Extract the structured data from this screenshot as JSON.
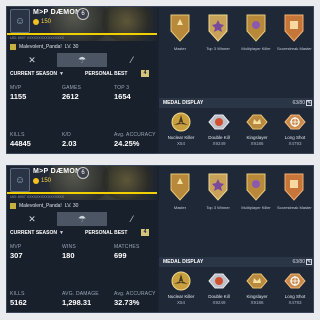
{
  "colors": {
    "accent_yellow": "#f0d000",
    "gold": "#d6b45a",
    "panel": "#1a2230"
  },
  "screens": [
    {
      "profile": {
        "name": "M>P",
        "clan_tag": "DÆMON",
        "level": "6",
        "cp": "150",
        "uid": "UID: 6907 XXXXXXXXXXXXXXXX",
        "title": "Malevolent_Panda!",
        "lv": "LV. 30",
        "current_season_label": "CURRENT SEASON",
        "personal_best_label": "PERSONAL BEST",
        "personal_best_count": "4"
      },
      "stats": [
        {
          "label": "MVP",
          "value": "1155"
        },
        {
          "label": "GAMES",
          "value": "2612"
        },
        {
          "label": "TOP 3",
          "value": "1654"
        },
        {
          "label": "KILLS",
          "value": "44845"
        },
        {
          "label": "K/D",
          "value": "2.03"
        },
        {
          "label": "Avg. ACCURACY",
          "value": "24.25%"
        }
      ],
      "medals": [
        "Master",
        "Top 3 Winner",
        "Multiplayer Killer",
        "Scorestreak Master"
      ],
      "medal_display_label": "MEDAL DISPLAY",
      "medal_display_count": "63/80",
      "display_medals": [
        {
          "name": "Nuclear Killer",
          "count": "X54"
        },
        {
          "name": "Double Kill",
          "count": "X9249"
        },
        {
          "name": "Kingslayer",
          "count": "X9186"
        },
        {
          "name": "Long Shot",
          "count": "X4793"
        }
      ]
    },
    {
      "profile": {
        "name": "M>P",
        "clan_tag": "DÆMON",
        "level": "6",
        "cp": "150",
        "uid": "UID: 6907 XXXXXXXXXXXXXXXX",
        "title": "Malevolent_Panda!",
        "lv": "LV. 30",
        "current_season_label": "CURRENT SEASON",
        "personal_best_label": "PERSONAL BEST",
        "personal_best_count": "4"
      },
      "stats": [
        {
          "label": "MVP",
          "value": "307"
        },
        {
          "label": "WINS",
          "value": "180"
        },
        {
          "label": "MATCHES",
          "value": "699"
        },
        {
          "label": "KILLS",
          "value": "5162"
        },
        {
          "label": "AVG. DAMAGE",
          "value": "1,298.31"
        },
        {
          "label": "Avg. ACCURACY",
          "value": "32.73%"
        }
      ],
      "medals": [
        "Master",
        "Top 3 Winner",
        "Multiplayer Killer",
        "Scorestreak Master"
      ],
      "medal_display_label": "MEDAL DISPLAY",
      "medal_display_count": "63/80",
      "display_medals": [
        {
          "name": "Nuclear Killer",
          "count": "X54"
        },
        {
          "name": "Double Kill",
          "count": "X9249"
        },
        {
          "name": "Kingslayer",
          "count": "X9186"
        },
        {
          "name": "Long Shot",
          "count": "X4793"
        }
      ]
    }
  ]
}
